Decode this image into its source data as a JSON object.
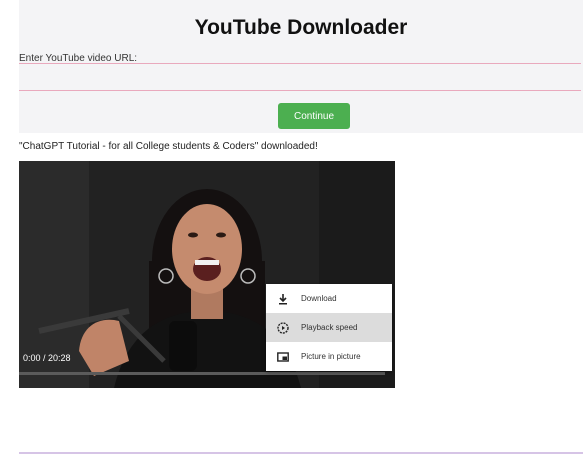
{
  "app": {
    "title": "YouTube Downloader",
    "url_label": "Enter YouTube video URL:",
    "url_value": "",
    "continue_label": "Continue",
    "status_message": "\"ChatGPT Tutorial - for all College students & Coders\" downloaded!"
  },
  "player": {
    "time_display": "0:00 / 20:28",
    "progress": 0.0,
    "menu": [
      {
        "label": "Download",
        "icon": "download-icon"
      },
      {
        "label": "Playback speed",
        "icon": "playback-speed-icon"
      },
      {
        "label": "Picture in picture",
        "icon": "picture-in-picture-icon"
      }
    ]
  },
  "colors": {
    "accent_button": "#4caf50",
    "input_border": "#e9a9bd"
  }
}
